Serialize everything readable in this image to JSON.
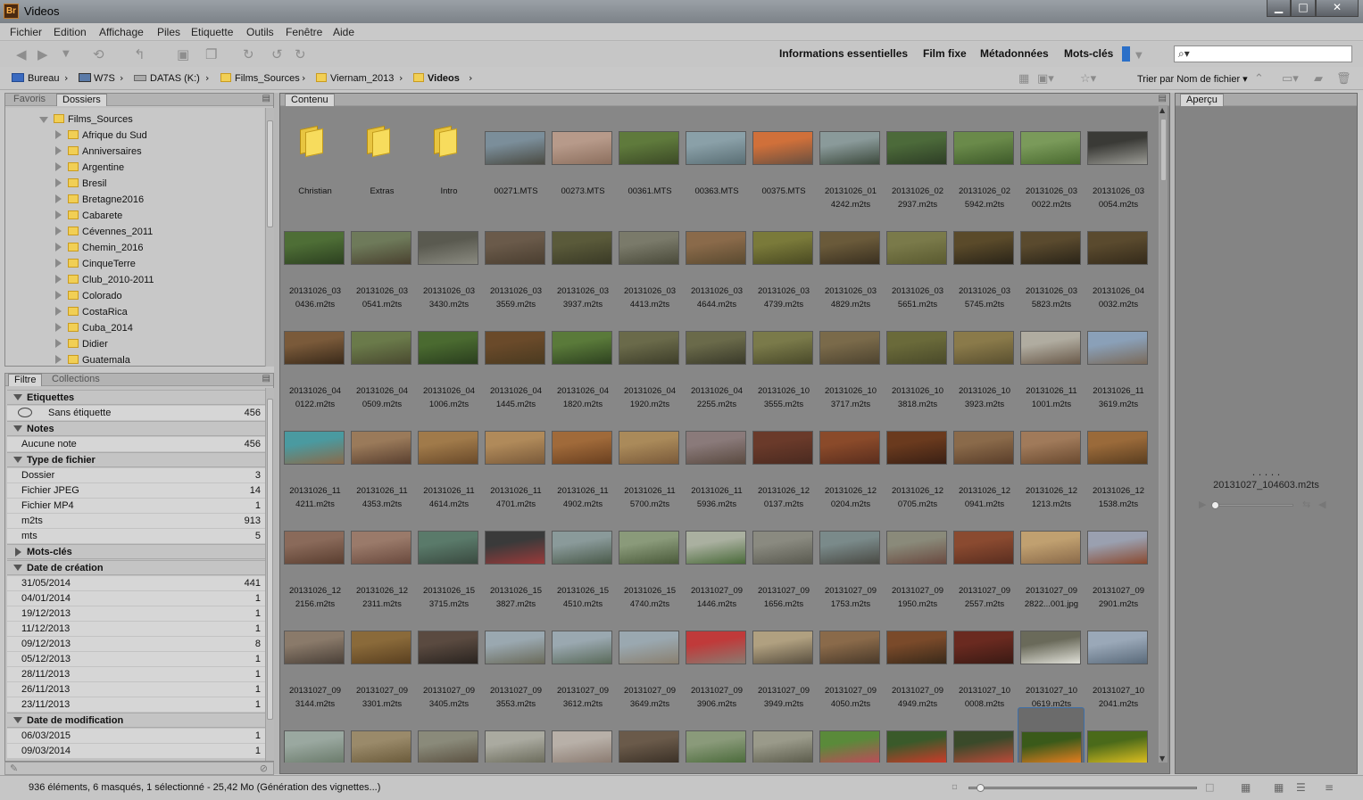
{
  "window": {
    "app_badge": "Br",
    "title": "Videos",
    "controls": [
      "▁",
      "□",
      "✕"
    ]
  },
  "menu": [
    "Fichier",
    "Edition",
    "Affichage",
    "Piles",
    "Etiquette",
    "Outils",
    "Fenêtre",
    "Aide"
  ],
  "workspaces": [
    "Informations essentielles",
    "Film fixe",
    "Métadonnées",
    "Mots-clés"
  ],
  "search": {
    "placeholder": ""
  },
  "breadcrumb": [
    "Bureau",
    "W7S",
    "DATAS (K:)",
    "Films_Sources",
    "Viernam_2013",
    "Videos"
  ],
  "sort_label": "Trier par Nom de fichier",
  "left_top_tabs": [
    "Favoris",
    "Dossiers"
  ],
  "folders": {
    "root": "Films_Sources",
    "children": [
      "Afrique du Sud",
      "Anniversaires",
      "Argentine",
      "Bresil",
      "Bretagne2016",
      "Cabarete",
      "Cévennes_2011",
      "Chemin_2016",
      "CinqueTerre",
      "Club_2010-2011",
      "Colorado",
      "CostaRica",
      "Cuba_2014",
      "Didier",
      "Guatemala"
    ]
  },
  "left_bottom_tabs": [
    "Filtre",
    "Collections"
  ],
  "filter": [
    {
      "header": "Etiquettes",
      "open": true,
      "rows": [
        {
          "label": "Sans étiquette",
          "count": "456",
          "icon": "no-label-icon"
        }
      ]
    },
    {
      "header": "Notes",
      "open": true,
      "rows": [
        {
          "label": "Aucune note",
          "count": "456"
        }
      ]
    },
    {
      "header": "Type de fichier",
      "open": true,
      "rows": [
        {
          "label": "Dossier",
          "count": "3"
        },
        {
          "label": "Fichier JPEG",
          "count": "14"
        },
        {
          "label": "Fichier MP4",
          "count": "1"
        },
        {
          "label": "m2ts",
          "count": "913"
        },
        {
          "label": "mts",
          "count": "5"
        }
      ]
    },
    {
      "header": "Mots-clés",
      "open": false,
      "rows": []
    },
    {
      "header": "Date de création",
      "open": true,
      "rows": [
        {
          "label": "31/05/2014",
          "count": "441"
        },
        {
          "label": "04/01/2014",
          "count": "1"
        },
        {
          "label": "19/12/2013",
          "count": "1"
        },
        {
          "label": "11/12/2013",
          "count": "1"
        },
        {
          "label": "09/12/2013",
          "count": "8"
        },
        {
          "label": "05/12/2013",
          "count": "1"
        },
        {
          "label": "28/11/2013",
          "count": "1"
        },
        {
          "label": "26/11/2013",
          "count": "1"
        },
        {
          "label": "23/11/2013",
          "count": "1"
        }
      ]
    },
    {
      "header": "Date de modification",
      "open": true,
      "rows": [
        {
          "label": "06/03/2015",
          "count": "1"
        },
        {
          "label": "09/03/2014",
          "count": "1"
        }
      ]
    }
  ],
  "content_tab": "Contenu",
  "content_items": [
    {
      "l1": "Christian",
      "l2": "",
      "type": "folder"
    },
    {
      "l1": "Extras",
      "l2": "",
      "type": "folder"
    },
    {
      "l1": "Intro",
      "l2": "",
      "type": "folder"
    },
    {
      "l1": "00271.MTS",
      "l2": "",
      "c": [
        "#7b8e9a",
        "#4a4a42"
      ]
    },
    {
      "l1": "00273.MTS",
      "l2": "",
      "c": [
        "#b79a8a",
        "#8c6f5e"
      ]
    },
    {
      "l1": "00361.MTS",
      "l2": "",
      "c": [
        "#5f7a3c",
        "#3c4a26"
      ]
    },
    {
      "l1": "00363.MTS",
      "l2": "",
      "c": [
        "#8aa0a8",
        "#5a6e74"
      ]
    },
    {
      "l1": "00375.MTS",
      "l2": "",
      "c": [
        "#d0703a",
        "#6a5040"
      ]
    },
    {
      "l1": "20131026_01",
      "l2": "4242.m2ts",
      "c": [
        "#8a9a9a",
        "#3d4a3d"
      ]
    },
    {
      "l1": "20131026_02",
      "l2": "2937.m2ts",
      "c": [
        "#4c6a3a",
        "#2e3e26"
      ]
    },
    {
      "l1": "20131026_02",
      "l2": "5942.m2ts",
      "c": [
        "#6a8a4a",
        "#3e5a2a"
      ]
    },
    {
      "l1": "20131026_03",
      "l2": "0022.m2ts",
      "c": [
        "#7a9a5a",
        "#4a6a30"
      ]
    },
    {
      "l1": "20131026_03",
      "l2": "0054.m2ts",
      "c": [
        "#3a3a36",
        "#9a9a94"
      ]
    },
    {
      "l1": "20131026_03",
      "l2": "0436.m2ts",
      "c": [
        "#4e6e36",
        "#2c4020"
      ]
    },
    {
      "l1": "20131026_03",
      "l2": "0541.m2ts",
      "c": [
        "#6e7a5a",
        "#4a4230"
      ]
    },
    {
      "l1": "20131026_03",
      "l2": "3430.m2ts",
      "c": [
        "#5a5a50",
        "#8a8a80"
      ]
    },
    {
      "l1": "20131026_03",
      "l2": "3559.m2ts",
      "c": [
        "#6a5a4a",
        "#4a3e30"
      ]
    },
    {
      "l1": "20131026_03",
      "l2": "3937.m2ts",
      "c": [
        "#5a5a3a",
        "#3a3a26"
      ]
    },
    {
      "l1": "20131026_03",
      "l2": "4413.m2ts",
      "c": [
        "#7a7a6a",
        "#4a4a3a"
      ]
    },
    {
      "l1": "20131026_03",
      "l2": "4644.m2ts",
      "c": [
        "#8a6a4a",
        "#5a4a30"
      ]
    },
    {
      "l1": "20131026_03",
      "l2": "4739.m2ts",
      "c": [
        "#7a7a3a",
        "#4a4a22"
      ]
    },
    {
      "l1": "20131026_03",
      "l2": "4829.m2ts",
      "c": [
        "#6a5a3a",
        "#3a3020"
      ]
    },
    {
      "l1": "20131026_03",
      "l2": "5651.m2ts",
      "c": [
        "#7a7a4a",
        "#5a5a30"
      ]
    },
    {
      "l1": "20131026_03",
      "l2": "5745.m2ts",
      "c": [
        "#5a4a2a",
        "#2a2418"
      ]
    },
    {
      "l1": "20131026_03",
      "l2": "5823.m2ts",
      "c": [
        "#5a4a2e",
        "#2a2418"
      ]
    },
    {
      "l1": "20131026_04",
      "l2": "0032.m2ts",
      "c": [
        "#5a4a2e",
        "#342a1a"
      ]
    },
    {
      "l1": "20131026_04",
      "l2": "0122.m2ts",
      "c": [
        "#7a5a3a",
        "#3a2a1a"
      ]
    },
    {
      "l1": "20131026_04",
      "l2": "0509.m2ts",
      "c": [
        "#6a7a4a",
        "#4a4a30"
      ]
    },
    {
      "l1": "20131026_04",
      "l2": "1006.m2ts",
      "c": [
        "#4a6a30",
        "#2a3e1e"
      ]
    },
    {
      "l1": "20131026_04",
      "l2": "1445.m2ts",
      "c": [
        "#6a4a2a",
        "#4a3a20"
      ]
    },
    {
      "l1": "20131026_04",
      "l2": "1820.m2ts",
      "c": [
        "#5a7a3a",
        "#2e4220"
      ]
    },
    {
      "l1": "20131026_04",
      "l2": "1920.m2ts",
      "c": [
        "#6a6a4a",
        "#3e3e2a"
      ]
    },
    {
      "l1": "20131026_04",
      "l2": "2255.m2ts",
      "c": [
        "#6a6a4a",
        "#3a3a2a"
      ]
    },
    {
      "l1": "20131026_10",
      "l2": "3555.m2ts",
      "c": [
        "#7a7a4a",
        "#4a4a2a"
      ]
    },
    {
      "l1": "20131026_10",
      "l2": "3717.m2ts",
      "c": [
        "#7a6a4a",
        "#4e4430"
      ]
    },
    {
      "l1": "20131026_10",
      "l2": "3818.m2ts",
      "c": [
        "#6a6a3a",
        "#4a4a2a"
      ]
    },
    {
      "l1": "20131026_10",
      "l2": "3923.m2ts",
      "c": [
        "#8a7a4a",
        "#5a5030"
      ]
    },
    {
      "l1": "20131026_11",
      "l2": "1001.m2ts",
      "c": [
        "#b0aca0",
        "#6a5a4a"
      ]
    },
    {
      "l1": "20131026_11",
      "l2": "3619.m2ts",
      "c": [
        "#8aa0b8",
        "#7a6a5a"
      ]
    },
    {
      "l1": "20131026_11",
      "l2": "4211.m2ts",
      "c": [
        "#4a9aa0",
        "#8a6a4a"
      ]
    },
    {
      "l1": "20131026_11",
      "l2": "4353.m2ts",
      "c": [
        "#9a7a5a",
        "#5a4030"
      ]
    },
    {
      "l1": "20131026_11",
      "l2": "4614.m2ts",
      "c": [
        "#a07a4a",
        "#6a4a2a"
      ]
    },
    {
      "l1": "20131026_11",
      "l2": "4701.m2ts",
      "c": [
        "#b08a5a",
        "#7a5a3a"
      ]
    },
    {
      "l1": "20131026_11",
      "l2": "4902.m2ts",
      "c": [
        "#a06a3a",
        "#6a4020"
      ]
    },
    {
      "l1": "20131026_11",
      "l2": "5700.m2ts",
      "c": [
        "#aa8a5a",
        "#7a5a3a"
      ]
    },
    {
      "l1": "20131026_11",
      "l2": "5936.m2ts",
      "c": [
        "#8a7a7a",
        "#5a4a40"
      ]
    },
    {
      "l1": "20131026_12",
      "l2": "0137.m2ts",
      "c": [
        "#6a3a2a",
        "#4a2a20"
      ]
    },
    {
      "l1": "20131026_12",
      "l2": "0204.m2ts",
      "c": [
        "#8a4a2a",
        "#5a2e1e"
      ]
    },
    {
      "l1": "20131026_12",
      "l2": "0705.m2ts",
      "c": [
        "#6a3a1e",
        "#3a2014"
      ]
    },
    {
      "l1": "20131026_12",
      "l2": "0941.m2ts",
      "c": [
        "#8a6a4a",
        "#5a3e2a"
      ]
    },
    {
      "l1": "20131026_12",
      "l2": "1213.m2ts",
      "c": [
        "#a07a5a",
        "#6a4a30"
      ]
    },
    {
      "l1": "20131026_12",
      "l2": "1538.m2ts",
      "c": [
        "#9a6a3a",
        "#5a3e20"
      ]
    },
    {
      "l1": "20131026_12",
      "l2": "2156.m2ts",
      "c": [
        "#8a6a5a",
        "#5a3e30"
      ]
    },
    {
      "l1": "20131026_12",
      "l2": "2311.m2ts",
      "c": [
        "#9a7a6a",
        "#6a4a3e"
      ]
    },
    {
      "l1": "20131026_15",
      "l2": "3715.m2ts",
      "c": [
        "#5a7a6a",
        "#3a4a40"
      ]
    },
    {
      "l1": "20131026_15",
      "l2": "3827.m2ts",
      "c": [
        "#3a3a3a",
        "#9a3a3a"
      ]
    },
    {
      "l1": "20131026_15",
      "l2": "4510.m2ts",
      "c": [
        "#8a9a9a",
        "#4a5a4a"
      ]
    },
    {
      "l1": "20131026_15",
      "l2": "4740.m2ts",
      "c": [
        "#8a9a7a",
        "#4a5a3a"
      ]
    },
    {
      "l1": "20131027_09",
      "l2": "1446.m2ts",
      "c": [
        "#aab0a0",
        "#4a6a3a"
      ]
    },
    {
      "l1": "20131027_09",
      "l2": "1656.m2ts",
      "c": [
        "#8a8a80",
        "#5a5a50"
      ]
    },
    {
      "l1": "20131027_09",
      "l2": "1753.m2ts",
      "c": [
        "#7a8a8a",
        "#4a4a44"
      ]
    },
    {
      "l1": "20131027_09",
      "l2": "1950.m2ts",
      "c": [
        "#8a8a7a",
        "#6a4a40"
      ]
    },
    {
      "l1": "20131027_09",
      "l2": "2557.m2ts",
      "c": [
        "#8a4a30",
        "#5a2e20"
      ]
    },
    {
      "l1": "20131027_09",
      "l2": "2822...001.jpg",
      "c": [
        "#c0a070",
        "#8a6a4a"
      ]
    },
    {
      "l1": "20131027_09",
      "l2": "2901.m2ts",
      "c": [
        "#9aa0b0",
        "#8a4a30"
      ]
    },
    {
      "l1": "20131027_09",
      "l2": "3144.m2ts",
      "c": [
        "#8a7a6a",
        "#4a4038"
      ]
    },
    {
      "l1": "20131027_09",
      "l2": "3301.m2ts",
      "c": [
        "#8a6a3a",
        "#5a4020"
      ]
    },
    {
      "l1": "20131027_09",
      "l2": "3405.m2ts",
      "c": [
        "#5a4a40",
        "#2a2420"
      ]
    },
    {
      "l1": "20131027_09",
      "l2": "3553.m2ts",
      "c": [
        "#9aa8b0",
        "#6a6a5a"
      ]
    },
    {
      "l1": "20131027_09",
      "l2": "3612.m2ts",
      "c": [
        "#9aa8b0",
        "#5a6a5a"
      ]
    },
    {
      "l1": "20131027_09",
      "l2": "3649.m2ts",
      "c": [
        "#9aa8b0",
        "#8a8070"
      ]
    },
    {
      "l1": "20131027_09",
      "l2": "3906.m2ts",
      "c": [
        "#c03a3a",
        "#8a7a70"
      ]
    },
    {
      "l1": "20131027_09",
      "l2": "3949.m2ts",
      "c": [
        "#b0a080",
        "#5a5040"
      ]
    },
    {
      "l1": "20131027_09",
      "l2": "4050.m2ts",
      "c": [
        "#8a6a4a",
        "#4a3a2a"
      ]
    },
    {
      "l1": "20131027_09",
      "l2": "4949.m2ts",
      "c": [
        "#7a4a2a",
        "#3a2a1a"
      ]
    },
    {
      "l1": "20131027_10",
      "l2": "0008.m2ts",
      "c": [
        "#6a2a20",
        "#3a1a14"
      ]
    },
    {
      "l1": "20131027_10",
      "l2": "0619.m2ts",
      "c": [
        "#6a6a5a",
        "#e0e0d8"
      ]
    },
    {
      "l1": "20131027_10",
      "l2": "2041.m2ts",
      "c": [
        "#9aa8b8",
        "#5a6a7a"
      ]
    },
    {
      "l1": "",
      "l2": "",
      "c": [
        "#9aa8a0",
        "#6a7a6a"
      ]
    },
    {
      "l1": "",
      "l2": "",
      "c": [
        "#9a8a6a",
        "#6a5a3a"
      ]
    },
    {
      "l1": "",
      "l2": "",
      "c": [
        "#8a8a7a",
        "#5a5040"
      ]
    },
    {
      "l1": "",
      "l2": "",
      "c": [
        "#aaaaa0",
        "#6a6a5a"
      ]
    },
    {
      "l1": "",
      "l2": "",
      "c": [
        "#b8b0a8",
        "#8a7a70"
      ]
    },
    {
      "l1": "",
      "l2": "",
      "c": [
        "#6a5a4a",
        "#3a3026"
      ]
    },
    {
      "l1": "",
      "l2": "",
      "c": [
        "#8a9a7a",
        "#4a6a3a"
      ]
    },
    {
      "l1": "",
      "l2": "",
      "c": [
        "#9a9a8a",
        "#5a5a4a"
      ]
    },
    {
      "l1": "",
      "l2": "",
      "c": [
        "#5a8a3a",
        "#c04a5a"
      ]
    },
    {
      "l1": "",
      "l2": "",
      "c": [
        "#3a5a2a",
        "#d03a2a"
      ]
    },
    {
      "l1": "",
      "l2": "",
      "c": [
        "#3a4a2a",
        "#c04a3a"
      ]
    },
    {
      "l1": "",
      "l2": "",
      "c": [
        "#3a5a1a",
        "#f08020"
      ],
      "selected": true
    },
    {
      "l1": "",
      "l2": "",
      "c": [
        "#4a6a1a",
        "#e0c020"
      ]
    }
  ],
  "preview_tab": "Aperçu",
  "preview_filename": "20131027_104603.m2ts",
  "preview_dots": ". . . . .",
  "status_text": "936 éléments, 6 masqués, 1 sélectionné - 25,42 Mo (Génération des vignettes...)"
}
